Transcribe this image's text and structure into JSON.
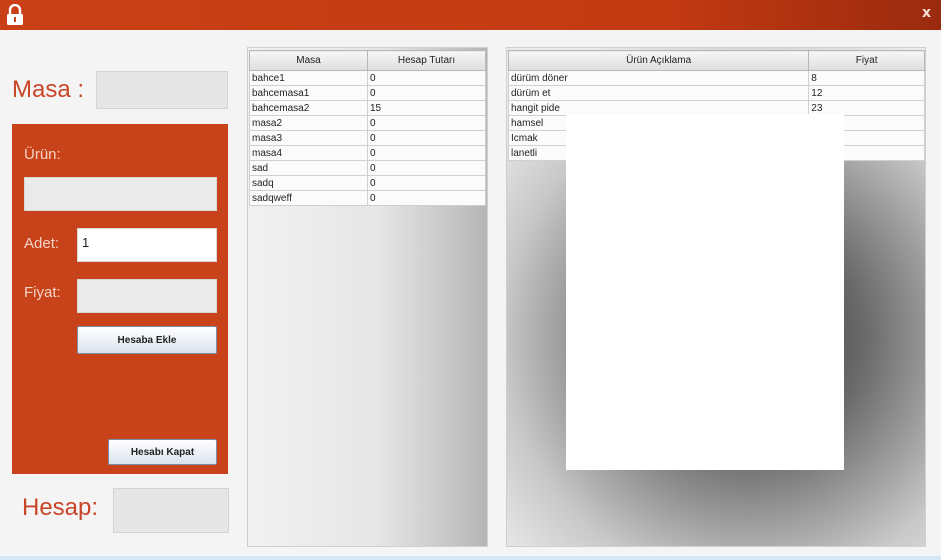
{
  "window": {
    "close_glyph": "x",
    "icon": "lock-icon",
    "accent_color": "#c8421a"
  },
  "sidebar": {
    "masa_label": "Masa :",
    "masa_value": "",
    "order": {
      "urun_label": "Ürün:",
      "urun_value": "",
      "adet_label": "Adet:",
      "adet_value": "1",
      "fiyat_label": "Fiyat:",
      "fiyat_value": "",
      "add_button": "Hesaba Ekle",
      "close_button": "Hesabı Kapat"
    },
    "hesap_label": "Hesap:",
    "hesap_value": ""
  },
  "tables_grid": {
    "headers": [
      "Masa",
      "Hesap Tutarı"
    ],
    "rows": [
      [
        "bahce1",
        "0"
      ],
      [
        "bahcemasa1",
        "0"
      ],
      [
        "bahcemasa2",
        "15"
      ],
      [
        "masa2",
        "0"
      ],
      [
        "masa3",
        "0"
      ],
      [
        "masa4",
        "0"
      ],
      [
        "sad",
        "0"
      ],
      [
        "sadq",
        "0"
      ],
      [
        "sadqweff",
        "0"
      ]
    ]
  },
  "orders_grid": {
    "headers": [
      "Ürün Açıklama",
      "Fiyat"
    ],
    "rows": [
      [
        "dürüm döner",
        "8"
      ],
      [
        "dürüm et",
        "12"
      ],
      [
        "hangit pide",
        "23"
      ],
      [
        "hamsel",
        ""
      ],
      [
        "Icmak",
        ""
      ],
      [
        "lanetli",
        ""
      ]
    ]
  }
}
